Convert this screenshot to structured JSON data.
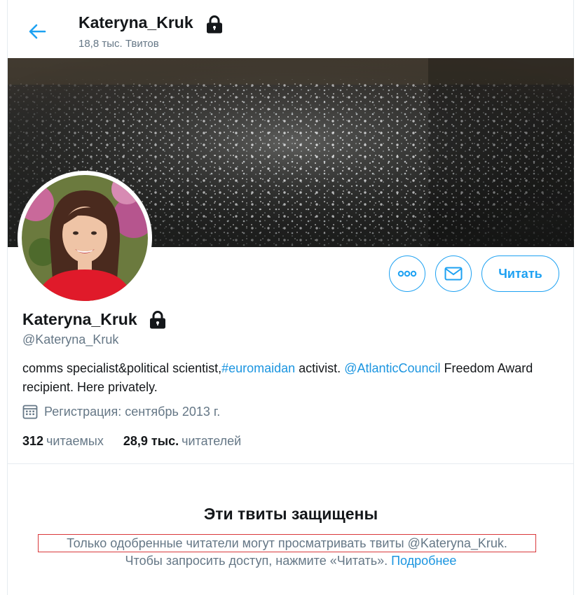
{
  "header": {
    "name": "Kateryna_Kruk",
    "tweet_count": "18,8 тыс. Твитов"
  },
  "profile": {
    "name": "Kateryna_Kruk",
    "handle": "@Kateryna_Kruk",
    "bio": {
      "part1": "comms specialist&political scientist,",
      "hashtag": "#euromaidan",
      "part2": " activist. ",
      "mention": "@AtlanticCouncil",
      "part3": " Freedom Award recipient. Here privately."
    },
    "joined": "Регистрация: сентябрь 2013 г.",
    "following_count": "312",
    "following_label": "читаемых",
    "followers_count": "28,9 тыс.",
    "followers_label": "читателей"
  },
  "actions": {
    "follow_label": "Читать"
  },
  "protected": {
    "title": "Эти твиты защищены",
    "line1": "Только одобренные читатели могут просматривать твиты @Kateryna_Kruk.",
    "line2": "Чтобы запросить доступ, нажмите «Читать».",
    "learn_more": "Подробнее"
  },
  "icons": {
    "back": "arrow-left-icon",
    "lock": "lock-icon",
    "more": "more-dots-icon",
    "message": "envelope-icon",
    "calendar": "calendar-icon"
  },
  "colors": {
    "accent": "#1da1f2",
    "link": "#1b95e0",
    "secondary_text": "#657786",
    "highlight_border": "#d9383b"
  }
}
